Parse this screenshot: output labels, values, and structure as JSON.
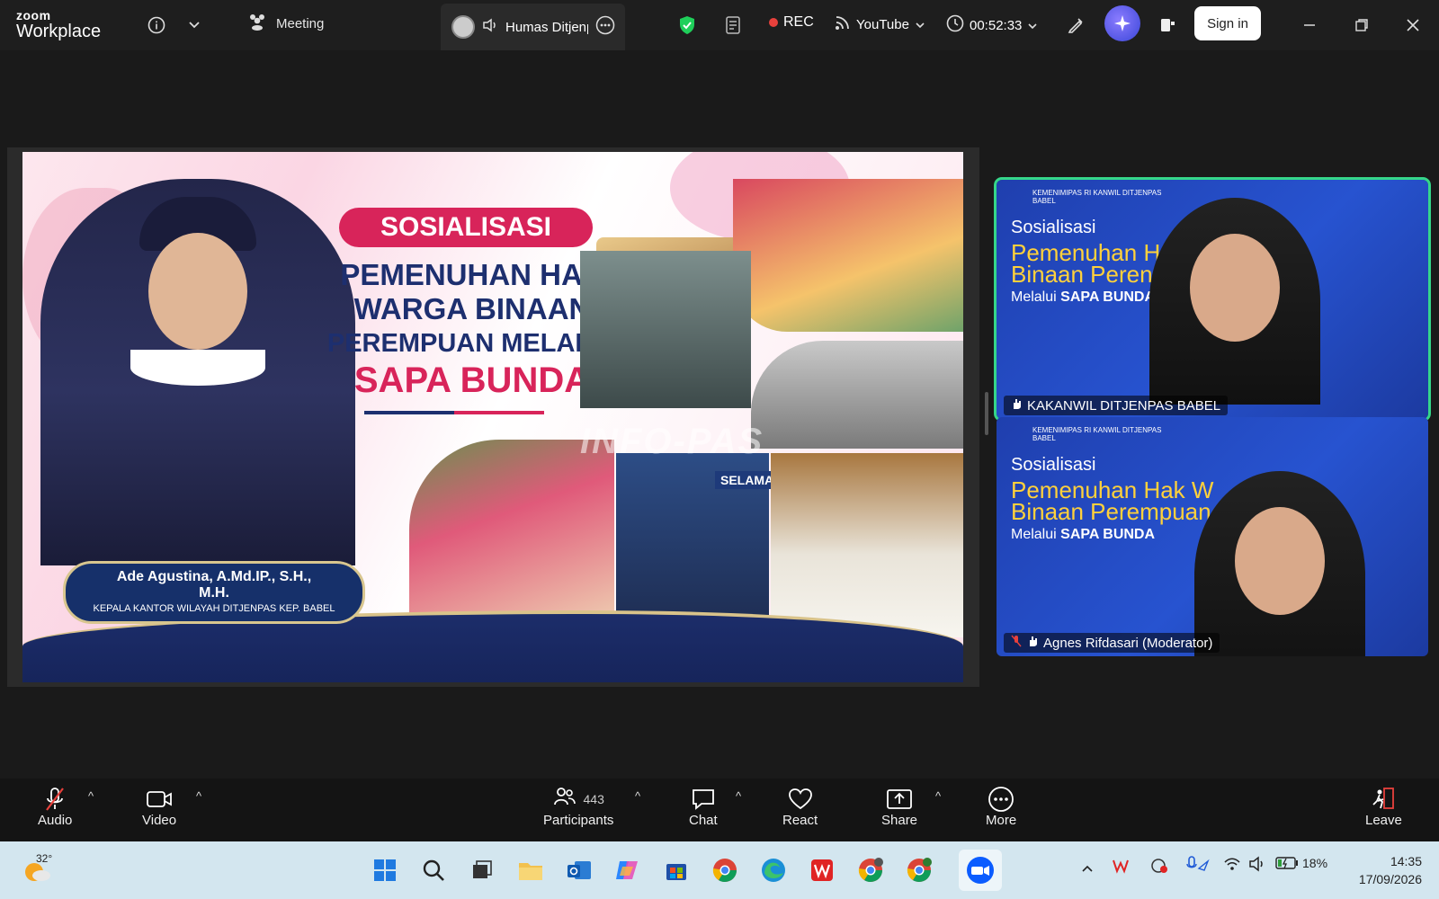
{
  "topbar": {
    "logo_small": "zoom",
    "logo_large": "Workplace",
    "meeting_label": "Meeting",
    "share_tab_label": "Humas Ditjenpas",
    "rec_label": "REC",
    "stream_label": "YouTube",
    "timer": "00:52:33",
    "signin_label": "Sign in",
    "colors": {
      "rec": "#e8413c",
      "shield": "#1fcf5a"
    }
  },
  "slide": {
    "badge": "SOSIALISASI",
    "title_lines": [
      "PEMENUHAN HAK",
      "WARGA BINAAN",
      "PEREMPUAN MELALUI"
    ],
    "title_accent": "SAPA BUNDA",
    "person_name": "Ade Agustina, A.Md.IP., S.H.,",
    "person_degree": "M.H.",
    "person_title": "KEPALA KANTOR WILAYAH DITJENPAS KEP. BABEL",
    "watermark": "INFO-PAS",
    "sign_text": "SELAMAT"
  },
  "tiles": [
    {
      "org": "KEMENIMIPAS RI KANWIL DITJENPAS BABEL",
      "line1": "Sosialisasi",
      "line2a": "Pemenuhan H",
      "line2b": "Binaan Peren",
      "line3_prefix": "Melalui",
      "line3_bold": "SAPA BUNDA",
      "participant": "KAKANWIL DITJENPAS BABEL"
    },
    {
      "org": "KEMENIMIPAS RI KANWIL DITJENPAS BABEL",
      "line1": "Sosialisasi",
      "line2a": "Pemenuhan Hak W",
      "line2b": "Binaan Perempuan",
      "line3_prefix": "Melalui",
      "line3_bold": "SAPA BUNDA",
      "participant": "Agnes Rifdasari (Moderator)"
    }
  ],
  "toolbar": {
    "audio": "Audio",
    "video": "Video",
    "participants": "Participants",
    "participants_count": "443",
    "chat": "Chat",
    "react": "React",
    "share": "Share",
    "more": "More",
    "leave": "Leave"
  },
  "taskbar": {
    "weather": "32°",
    "battery": "18%",
    "time": "14:35",
    "date": "17/09/2026"
  }
}
